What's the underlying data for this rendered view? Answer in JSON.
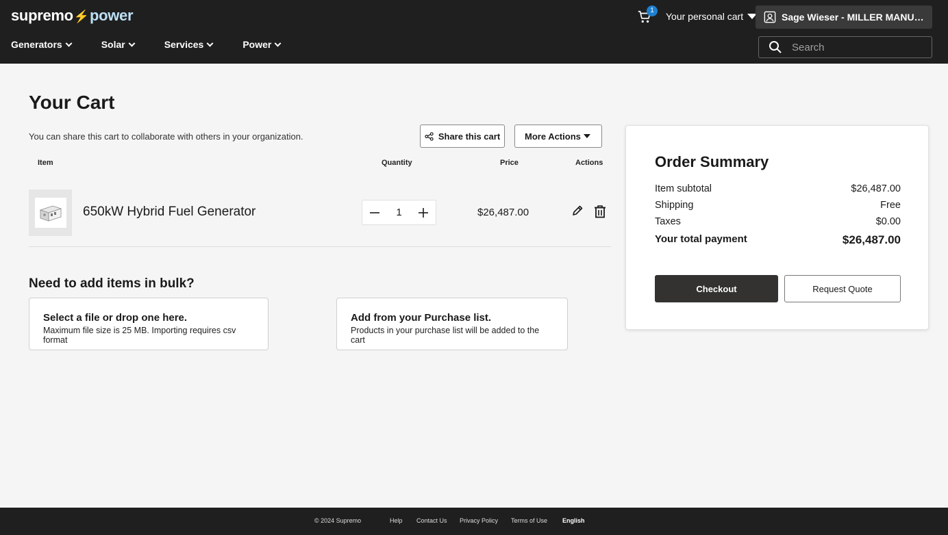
{
  "brand": {
    "logo_left": "supremo",
    "logo_right": "power",
    "accent": "#1e90d8"
  },
  "header": {
    "cart_count": "1",
    "personal_cart_label": "Your personal cart",
    "account_label": "Sage Wieser - MILLER MANUFACTURING",
    "search_placeholder": "Search"
  },
  "nav": [
    {
      "label": "Generators"
    },
    {
      "label": "Solar"
    },
    {
      "label": "Services"
    },
    {
      "label": "Power"
    }
  ],
  "cart": {
    "title": "Your Cart",
    "share_note": "You can share this cart to collaborate with others in your organization.",
    "share_button": "Share this cart",
    "more_actions": "More Actions",
    "columns": {
      "item": "Item",
      "quantity": "Quantity",
      "price": "Price",
      "actions": "Actions"
    },
    "items": [
      {
        "name": "650kW Hybrid Fuel Generator",
        "quantity": "1",
        "price": "$26,487.00"
      }
    ]
  },
  "bulk": {
    "title": "Need to add items in bulk?",
    "file_card": {
      "title": "Select a file or drop one here.",
      "subtitle": "Maximum file size is 25 MB. Importing requires csv format"
    },
    "list_card": {
      "title": "Add from your Purchase list.",
      "subtitle": "Products in your purchase list will be added to the cart"
    }
  },
  "summary": {
    "title": "Order Summary",
    "rows": [
      {
        "label": "Item subtotal",
        "value": "$26,487.00"
      },
      {
        "label": "Shipping",
        "value": "Free"
      },
      {
        "label": "Taxes",
        "value": "$0.00"
      }
    ],
    "total_label": "Your total payment",
    "total_value": "$26,487.00",
    "checkout": "Checkout",
    "quote": "Request Quote"
  },
  "footer": {
    "copyright": "© 2024 Supremo",
    "links": [
      "Help",
      "Contact Us",
      "Privacy Policy",
      "Terms of Use"
    ],
    "language": "English"
  }
}
